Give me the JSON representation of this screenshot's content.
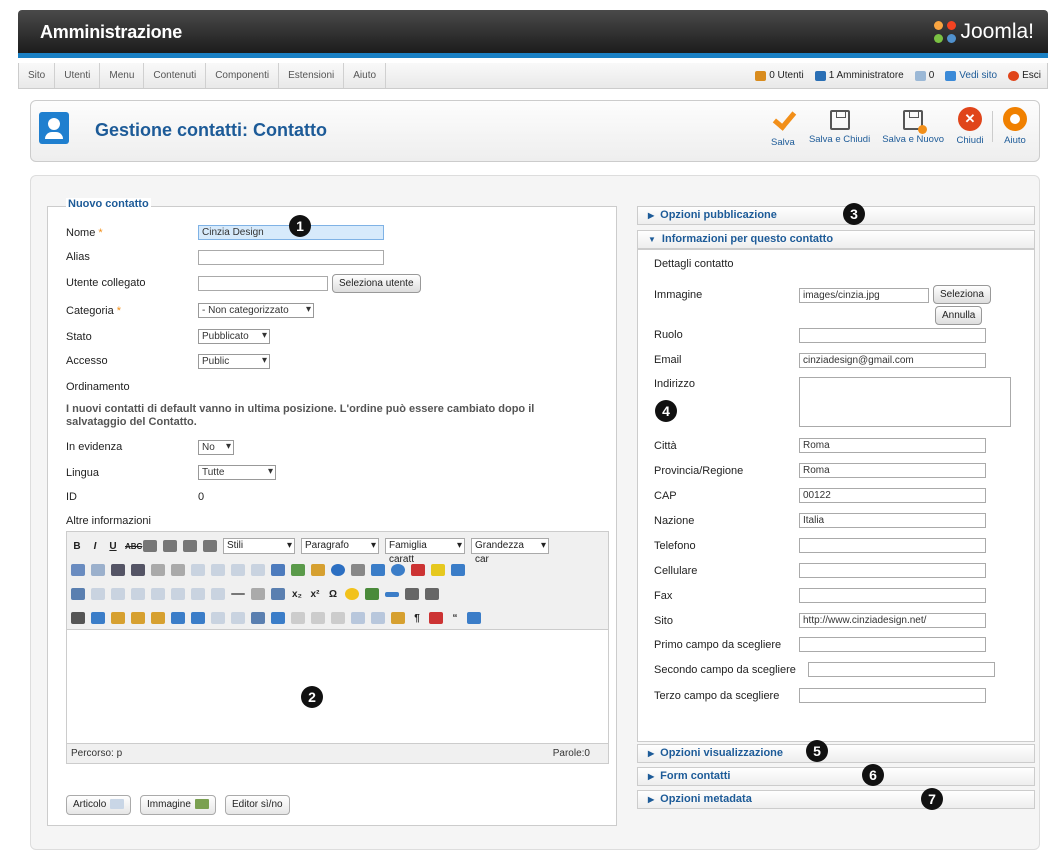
{
  "header": {
    "title": "Amministrazione",
    "logo_text": "Joomla!"
  },
  "menu": {
    "items": [
      "Sito",
      "Utenti",
      "Menu",
      "Contenuti",
      "Componenti",
      "Estensioni",
      "Aiuto"
    ]
  },
  "status": {
    "users": "0 Utenti",
    "admins": "1 Amministratore",
    "messages": "0",
    "view_site": "Vedi sito",
    "logout": "Esci"
  },
  "toolbar": {
    "page_title": "Gestione contatti: Contatto",
    "save": "Salva",
    "save_close": "Salva e Chiudi",
    "save_new": "Salva e Nuovo",
    "close": "Chiudi",
    "help": "Aiuto"
  },
  "form": {
    "legend": "Nuovo contatto",
    "name_label": "Nome",
    "name_value": "Cinzia Design",
    "alias_label": "Alias",
    "user_label": "Utente collegato",
    "user_button": "Seleziona utente",
    "category_label": "Categoria",
    "category_value": "- Non categorizzato",
    "state_label": "Stato",
    "state_value": "Pubblicato",
    "access_label": "Accesso",
    "access_value": "Public",
    "ordering_label": "Ordinamento",
    "ordering_note": "I nuovi contatti di default vanno in ultima posizione. L'ordine può essere cambiato dopo il salvataggio del Contatto.",
    "featured_label": "In evidenza",
    "featured_value": "No",
    "language_label": "Lingua",
    "language_value": "Tutte",
    "id_label": "ID",
    "id_value": "0",
    "misc_label": "Altre informazioni"
  },
  "editor": {
    "styles": "Stili",
    "format": "Paragrafo",
    "font_family": "Famiglia caratt",
    "font_size": "Grandezza car",
    "path": "Percorso: p",
    "words": "Parole:0",
    "btn_article": "Articolo",
    "btn_image": "Immagine",
    "btn_toggle": "Editor sì/no"
  },
  "panels": {
    "publishing": "Opzioni pubblicazione",
    "contact_info": "Informazioni per questo contatto",
    "display": "Opzioni visualizzazione",
    "form": "Form contatti",
    "metadata": "Opzioni metadata"
  },
  "contact": {
    "details_label": "Dettagli contatto",
    "image_label": "Immagine",
    "image_value": "images/cinzia.jpg",
    "select_btn": "Seleziona",
    "cancel_btn": "Annulla",
    "role_label": "Ruolo",
    "email_label": "Email",
    "email_value": "cinziadesign@gmail.com",
    "address_label": "Indirizzo",
    "city_label": "Città",
    "city_value": "Roma",
    "state_label": "Provincia/Regione",
    "state_value": "Roma",
    "zip_label": "CAP",
    "zip_value": "00122",
    "country_label": "Nazione",
    "country_value": "Italia",
    "phone_label": "Telefono",
    "mobile_label": "Cellulare",
    "fax_label": "Fax",
    "site_label": "Sito",
    "site_value": "http://www.cinziadesign.net/",
    "field1_label": "Primo campo da scegliere",
    "field2_label": "Secondo campo da scegliere",
    "field3_label": "Terzo campo da scegliere"
  },
  "callouts": [
    "1",
    "2",
    "3",
    "4",
    "5",
    "6",
    "7"
  ],
  "colors": {
    "brand_blue": "#1d5b98",
    "accent_orange": "#f28f19",
    "header_bar": "#1a80c4"
  }
}
